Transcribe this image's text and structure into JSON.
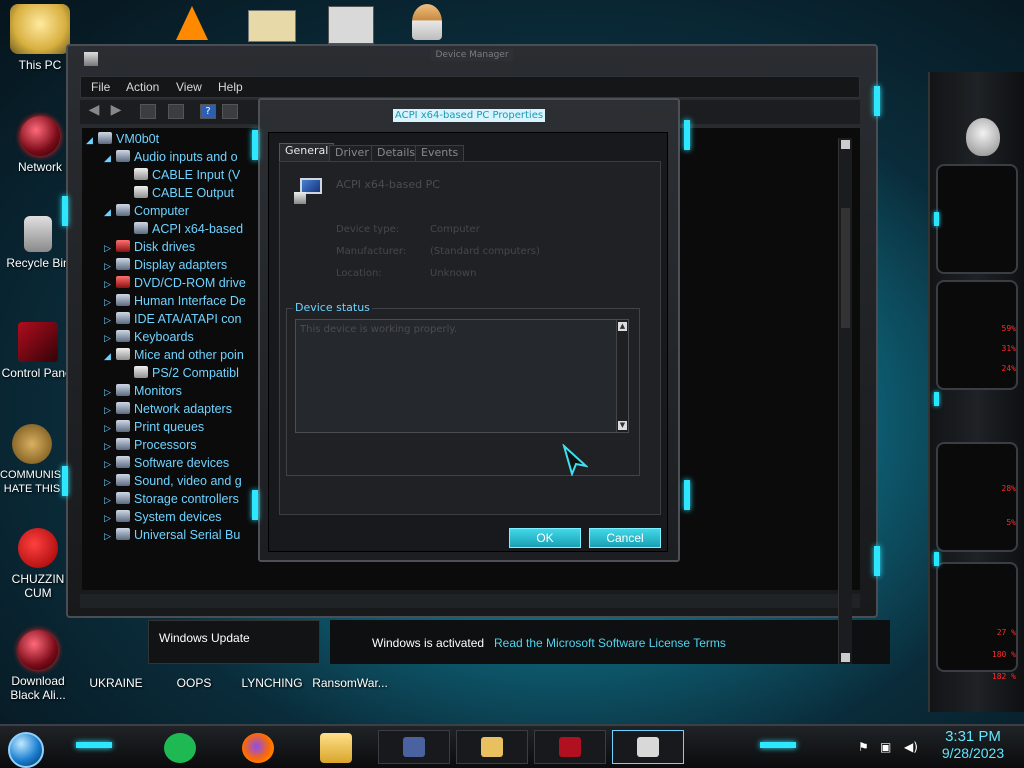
{
  "desktop": {
    "icons": [
      {
        "label": "This PC"
      },
      {
        "label": "Network"
      },
      {
        "label": "Recycle Bin"
      },
      {
        "label": "Control Panel"
      },
      {
        "label": "COMMUNISM HATE THIS C"
      },
      {
        "label": "CHUZZIN CUM"
      },
      {
        "label": "Download Black Ali..."
      },
      {
        "label": "UKRAINE"
      },
      {
        "label": "OOPS"
      },
      {
        "label": "LYNCHING"
      },
      {
        "label": "RansomWar..."
      }
    ]
  },
  "side_panel": {
    "readouts": [
      "59%",
      "31%",
      "24%",
      "28%",
      "5%",
      "27 %",
      "180 %",
      "182 %"
    ]
  },
  "device_manager": {
    "title": "Device Manager",
    "menu": [
      "File",
      "Action",
      "View",
      "Help"
    ],
    "tree": [
      {
        "label": "VM0b0t",
        "expanded": "◢",
        "level": 0,
        "icon": "computer-icon"
      },
      {
        "label": "Audio inputs and o",
        "expanded": "◢",
        "level": 1,
        "icon": "speaker-icon"
      },
      {
        "label": "CABLE Input (V",
        "expanded": "",
        "level": 2,
        "icon": "audio-device-icon"
      },
      {
        "label": "CABLE Output",
        "expanded": "",
        "level": 2,
        "icon": "audio-device-icon"
      },
      {
        "label": "Computer",
        "expanded": "◢",
        "level": 1,
        "icon": "computer-icon"
      },
      {
        "label": "ACPI x64-based",
        "expanded": "",
        "level": 2,
        "icon": "computer-icon"
      },
      {
        "label": "Disk drives",
        "expanded": "▷",
        "level": 1,
        "icon": "disk-icon"
      },
      {
        "label": "Display adapters",
        "expanded": "▷",
        "level": 1,
        "icon": "display-icon"
      },
      {
        "label": "DVD/CD-ROM drive",
        "expanded": "▷",
        "level": 1,
        "icon": "dvd-icon"
      },
      {
        "label": "Human Interface De",
        "expanded": "▷",
        "level": 1,
        "icon": "hid-icon"
      },
      {
        "label": "IDE ATA/ATAPI con",
        "expanded": "▷",
        "level": 1,
        "icon": "ide-icon"
      },
      {
        "label": "Keyboards",
        "expanded": "▷",
        "level": 1,
        "icon": "keyboard-icon"
      },
      {
        "label": "Mice and other poin",
        "expanded": "◢",
        "level": 1,
        "icon": "mouse-icon"
      },
      {
        "label": "PS/2 Compatibl",
        "expanded": "",
        "level": 2,
        "icon": "mouse-icon"
      },
      {
        "label": "Monitors",
        "expanded": "▷",
        "level": 1,
        "icon": "monitor-icon"
      },
      {
        "label": "Network adapters",
        "expanded": "▷",
        "level": 1,
        "icon": "network-icon"
      },
      {
        "label": "Print queues",
        "expanded": "▷",
        "level": 1,
        "icon": "printer-icon"
      },
      {
        "label": "Processors",
        "expanded": "▷",
        "level": 1,
        "icon": "cpu-icon"
      },
      {
        "label": "Software devices",
        "expanded": "▷",
        "level": 1,
        "icon": "software-icon"
      },
      {
        "label": "Sound, video and g",
        "expanded": "▷",
        "level": 1,
        "icon": "sound-icon"
      },
      {
        "label": "Storage controllers",
        "expanded": "▷",
        "level": 1,
        "icon": "storage-icon"
      },
      {
        "label": "System devices",
        "expanded": "▷",
        "level": 1,
        "icon": "system-icon"
      },
      {
        "label": "Universal Serial Bu",
        "expanded": "▷",
        "level": 1,
        "icon": "usb-icon"
      }
    ]
  },
  "properties": {
    "title": "ACPI x64-based PC Properties",
    "tabs": [
      "General",
      "Driver",
      "Details",
      "Events"
    ],
    "device_name": "ACPI x64-based PC",
    "fields": [
      {
        "label": "Device type:",
        "value": "Computer"
      },
      {
        "label": "Manufacturer:",
        "value": "(Standard computers)"
      },
      {
        "label": "Location:",
        "value": "Unknown"
      }
    ],
    "status_legend": "Device status",
    "status_text": "This device is working properly.",
    "ok_label": "OK",
    "cancel_label": "Cancel"
  },
  "background": {
    "windows_update": "Windows Update",
    "activated": "Windows is activated",
    "license_link": "Read the Microsoft Software License Terms"
  },
  "taskbar": {
    "time": "3:31 PM",
    "date": "9/28/2023"
  },
  "colors": {
    "accent": "#29e6ff",
    "tree_text": "#6fd3ff",
    "alert_red": "#ff2b2b"
  }
}
